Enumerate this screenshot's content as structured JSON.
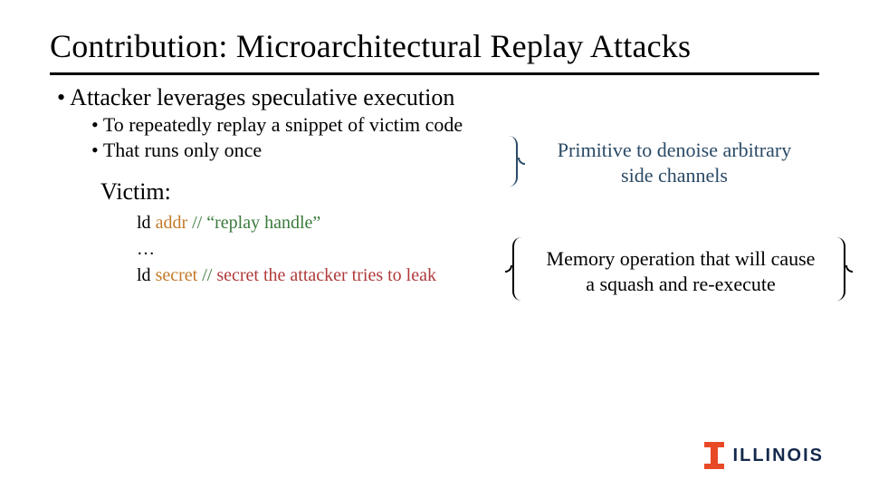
{
  "title": "Contribution: Microarchitectural Replay Attacks",
  "bullets": {
    "l1": "Attacker leverages speculative execution",
    "l2a": "To repeatedly replay a snippet of victim code",
    "l2b": "That runs only once"
  },
  "victim_label": "Victim:",
  "code": {
    "line1_kw": "ld ",
    "line1_addr": "addr ",
    "line1_cm": "// “replay handle”",
    "line2": "…",
    "line3_kw": "ld ",
    "line3_addr": "secret ",
    "line3_cm_pre": "// ",
    "line3_cm_sec": "secret the attacker tries to leak"
  },
  "annot1_l1": "Primitive to denoise arbitrary",
  "annot1_l2": "side channels",
  "annot2_l1": "Memory operation that will cause",
  "annot2_l2": "a squash and re-execute",
  "logo_text": "ILLINOIS"
}
